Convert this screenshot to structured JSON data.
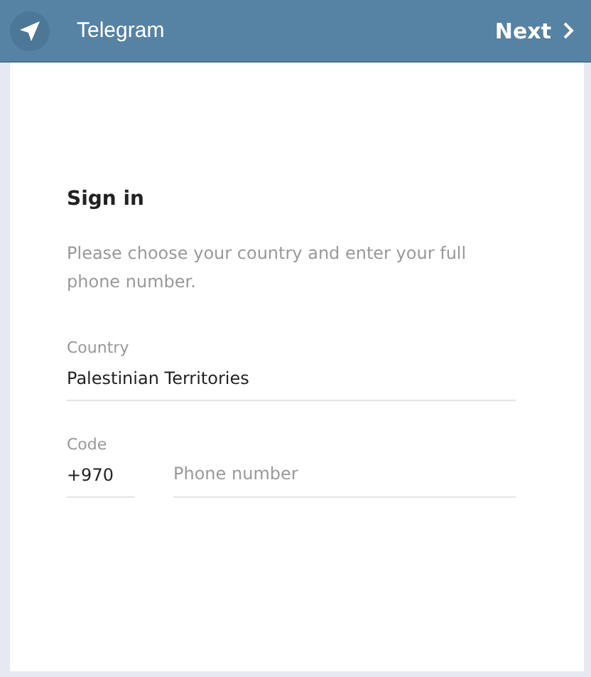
{
  "header": {
    "title": "Telegram",
    "next_button": "Next"
  },
  "form": {
    "heading": "Sign in",
    "description": "Please choose your country and enter your full phone number.",
    "country": {
      "label": "Country",
      "value": "Palestinian Territories"
    },
    "code": {
      "label": "Code",
      "value": "+970"
    },
    "phone": {
      "placeholder": "Phone number"
    }
  }
}
